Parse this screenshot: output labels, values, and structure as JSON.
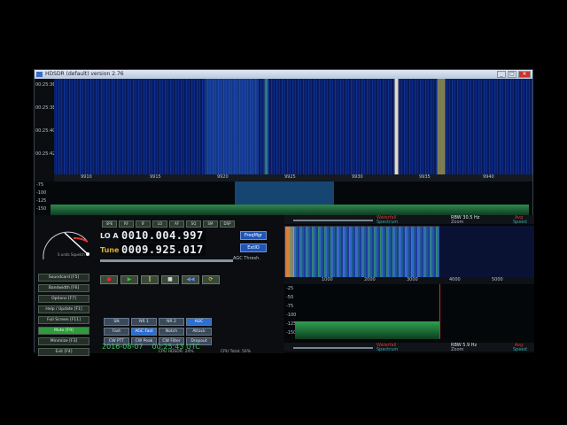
{
  "window": {
    "title": "HDSDR (default)  version 2.76"
  },
  "waterfall": {
    "times": [
      "00:25:36",
      "00:25:38",
      "00:25:40",
      "00:25:42"
    ],
    "freq_ticks": [
      "9910",
      "9915",
      "9920",
      "9925",
      "9930",
      "9935",
      "9940"
    ]
  },
  "spectrum": {
    "levels": [
      "-75",
      "-100",
      "-125",
      "-150"
    ]
  },
  "smeter": {
    "label": "S units\nSquelch"
  },
  "toolbar": {
    "buttons": [
      "SPE",
      "RF",
      "IF",
      "LO",
      "AF",
      "SQ",
      "SM",
      "DSP"
    ]
  },
  "tuning": {
    "lo_label": "LO A",
    "lo_value": "0010.004.997",
    "tune_label": "Tune",
    "tune_value": "0009.925.017",
    "freqmgr_label": "FreqMgr",
    "extio_label": "ExtIO",
    "agc_thresh_label": "AGC Thresh."
  },
  "transport": [
    "●",
    "▶",
    "‖",
    "■",
    "◀◀",
    "⟳"
  ],
  "left_buttons": [
    {
      "label": "Soundcard  [F5]"
    },
    {
      "label": "Bandwidth  [F6]"
    },
    {
      "label": "Options  [F7]"
    },
    {
      "label": "Help / Update  [F1]"
    },
    {
      "label": "Full Screen  [F11]"
    },
    {
      "label": "Mute  [F9]",
      "on": true
    },
    {
      "label": "Minimize  [F3]"
    },
    {
      "label": "Exit  [F4]"
    }
  ],
  "modes": [
    {
      "label": "SN"
    },
    {
      "label": "NR 1"
    },
    {
      "label": "NR 2"
    },
    {
      "label": "AGC",
      "on": true
    },
    {
      "label": "Fast"
    },
    {
      "label": "AGC Fast",
      "on": true
    },
    {
      "label": "Notch"
    },
    {
      "label": "Attack"
    },
    {
      "label": "CW PTT"
    },
    {
      "label": "CW Peak"
    },
    {
      "label": "CW Filter"
    },
    {
      "label": "Dropout"
    }
  ],
  "datetime": {
    "date": "2016-08-07",
    "time": "00:25:43 UTC"
  },
  "cpu": {
    "hdsdr": "CPU HDSDR:  24%",
    "total": "CPU Total:  56%"
  },
  "zoom": {
    "top_waterfall_label": "Waterfall",
    "top_rbw": "RBW  30.5 Hz",
    "top_spectrum_label": "Spectrum",
    "top_zoom_label": "Zoom",
    "top_speed_label": "Speed",
    "top_avg_label": "Avg",
    "ticks": [
      "1000",
      "2000",
      "3000",
      "4000",
      "5000"
    ],
    "levels": [
      "-25",
      "-50",
      "-75",
      "-100",
      "-125",
      "-150"
    ],
    "bottom_waterfall_label": "Waterfall",
    "bottom_rbw": "RBW  5.9 Hz",
    "bottom_spectrum_label": "Spectrum",
    "bottom_zoom_label": "Zoom",
    "bottom_speed_label": "Speed",
    "bottom_avg_label": "Avg"
  },
  "colors": {
    "waterfall_bg": "#0a1f6a",
    "freq_display_bg": "#050607",
    "tune_label": "#d8b230",
    "active_button": "#2a6fd1",
    "mute_button": "#2f9b3a",
    "clock_text": "#3fc059"
  }
}
